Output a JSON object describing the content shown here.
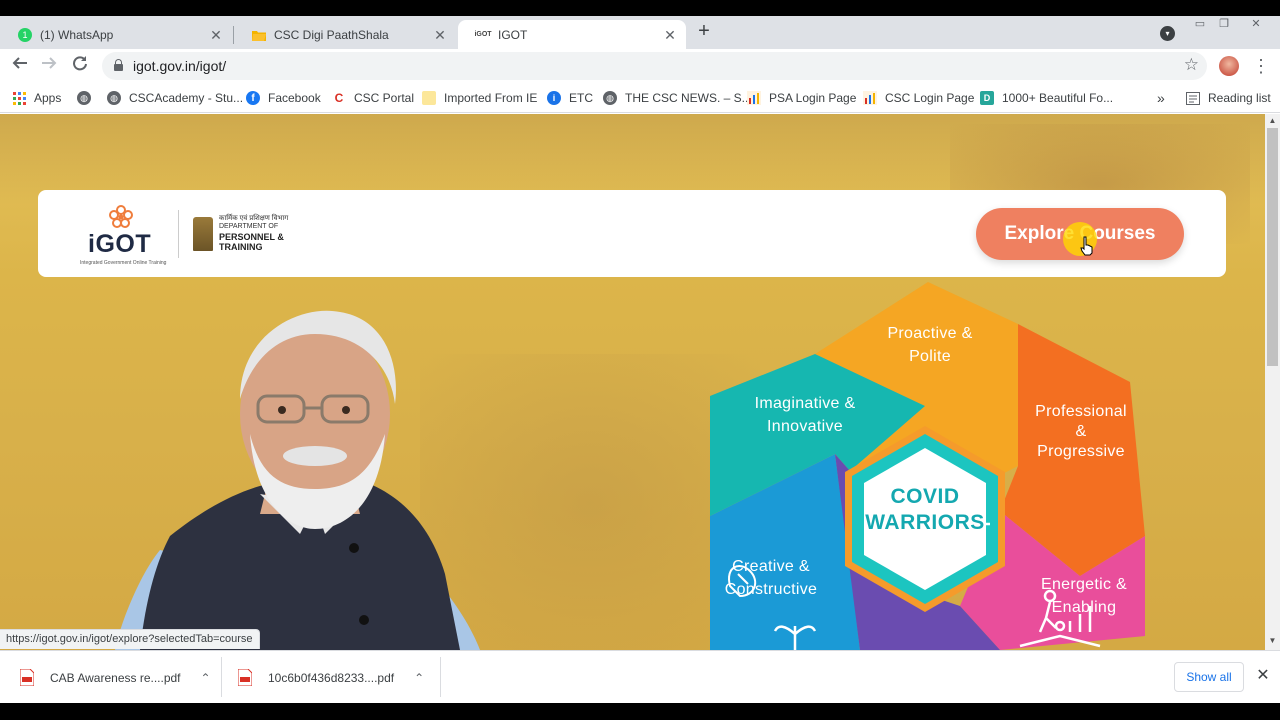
{
  "browser": {
    "tabs": [
      {
        "label": "(1) WhatsApp",
        "icon": "whatsapp-icon"
      },
      {
        "label": "CSC Digi PaathShala",
        "icon": "folder-icon"
      },
      {
        "label": "IGOT",
        "icon": "igot-icon"
      }
    ],
    "url": "igot.gov.in/igot/",
    "bookmarks": [
      {
        "label": "Apps",
        "icon": "apps-grid-icon"
      },
      {
        "label": "",
        "icon": "globe-icon"
      },
      {
        "label": "CSCAcademy - Stu...",
        "icon": "globe-icon"
      },
      {
        "label": "Facebook",
        "icon": "facebook-icon"
      },
      {
        "label": "CSC Portal",
        "icon": "csc-icon"
      },
      {
        "label": "Imported From IE",
        "icon": "folder-icon"
      },
      {
        "label": "ETC",
        "icon": "info-icon"
      },
      {
        "label": "THE CSC NEWS. – S...",
        "icon": "globe-icon"
      },
      {
        "label": "PSA Login Page",
        "icon": "chart-icon"
      },
      {
        "label": "CSC Login Page",
        "icon": "chart-icon"
      },
      {
        "label": "1000+ Beautiful Fo...",
        "icon": "d-icon"
      }
    ],
    "bookmarks_overflow": "»",
    "reading_list": "Reading list",
    "status_url": "https://igot.gov.in/igot/explore?selectedTab=course"
  },
  "page": {
    "logo_text": "iGOT",
    "logo_tagline": "Integrated Government Online Training",
    "dept_hindi": "कार्मिक एवं प्रशिक्षण विभाग",
    "dept_line1": "DEPARTMENT OF",
    "dept_line2": "PERSONNEL & TRAINING",
    "explore_button": "Explore Courses",
    "hexagon": {
      "segments": [
        {
          "label": "Proactive & Polite",
          "lines": [
            "Proactive &",
            "Polite"
          ],
          "color": "#f5a623"
        },
        {
          "label": "Professional & Progressive",
          "lines": [
            "Professional",
            "&",
            "Progressive"
          ],
          "color": "#f36f21"
        },
        {
          "label": "Energetic & Enabling",
          "lines": [
            "Energetic &",
            "Enabling"
          ],
          "color": "#e94e9b"
        },
        {
          "label": "Creative & Constructive",
          "lines": [
            "Creative &",
            "Constructive"
          ],
          "color": "#1b9ad6"
        },
        {
          "label": "Imaginative & Innovative",
          "lines": [
            "Imaginative &",
            "Innovative"
          ],
          "color": "#16b7b0"
        }
      ],
      "center": [
        "COVID",
        "WARRIORS"
      ]
    }
  },
  "downloads": [
    {
      "name": "CAB Awareness re....pdf"
    },
    {
      "name": "10c6b0f436d8233....pdf"
    }
  ],
  "show_all": "Show all"
}
